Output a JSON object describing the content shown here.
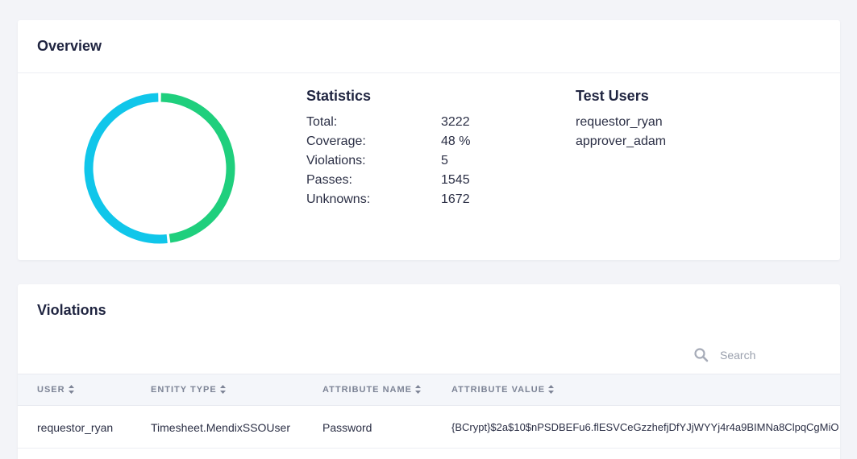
{
  "overview": {
    "title": "Overview",
    "chart_data": {
      "type": "pie",
      "categories": [
        "Passes",
        "Unknowns"
      ],
      "values": [
        1545,
        1672
      ],
      "colors": [
        "#1fcf7d",
        "#10c6ea"
      ]
    },
    "statistics": {
      "title": "Statistics",
      "rows": [
        {
          "label": "Total:",
          "value": "3222"
        },
        {
          "label": "Coverage:",
          "value": "48 %"
        },
        {
          "label": "Violations:",
          "value": "5"
        },
        {
          "label": "Passes:",
          "value": "1545"
        },
        {
          "label": "Unknowns:",
          "value": "1672"
        }
      ]
    },
    "test_users": {
      "title": "Test Users",
      "items": [
        "requestor_ryan",
        "approver_adam"
      ]
    }
  },
  "violations": {
    "title": "Violations",
    "search": {
      "placeholder": "Search",
      "value": ""
    },
    "columns": [
      "USER",
      "ENTITY TYPE",
      "ATTRIBUTE NAME",
      "ATTRIBUTE VALUE"
    ],
    "rows": [
      {
        "user": "requestor_ryan",
        "entity_type": "Timesheet.MendixSSOUser",
        "attribute_name": "Password",
        "attribute_value": "{BCrypt}$2a$10$nPSDBEFu6.flESVCeGzzhefjDfYJjWYYj4r4a9BIMNa8ClpqCgMiO"
      }
    ]
  },
  "colors": {
    "background": "#f3f4f8",
    "card": "#ffffff",
    "pass_green": "#1fcf7d",
    "unknown_blue": "#10c6ea",
    "header_text": "#7d8496"
  },
  "icons": {
    "search": "search-icon",
    "sort": "sort-icon"
  }
}
